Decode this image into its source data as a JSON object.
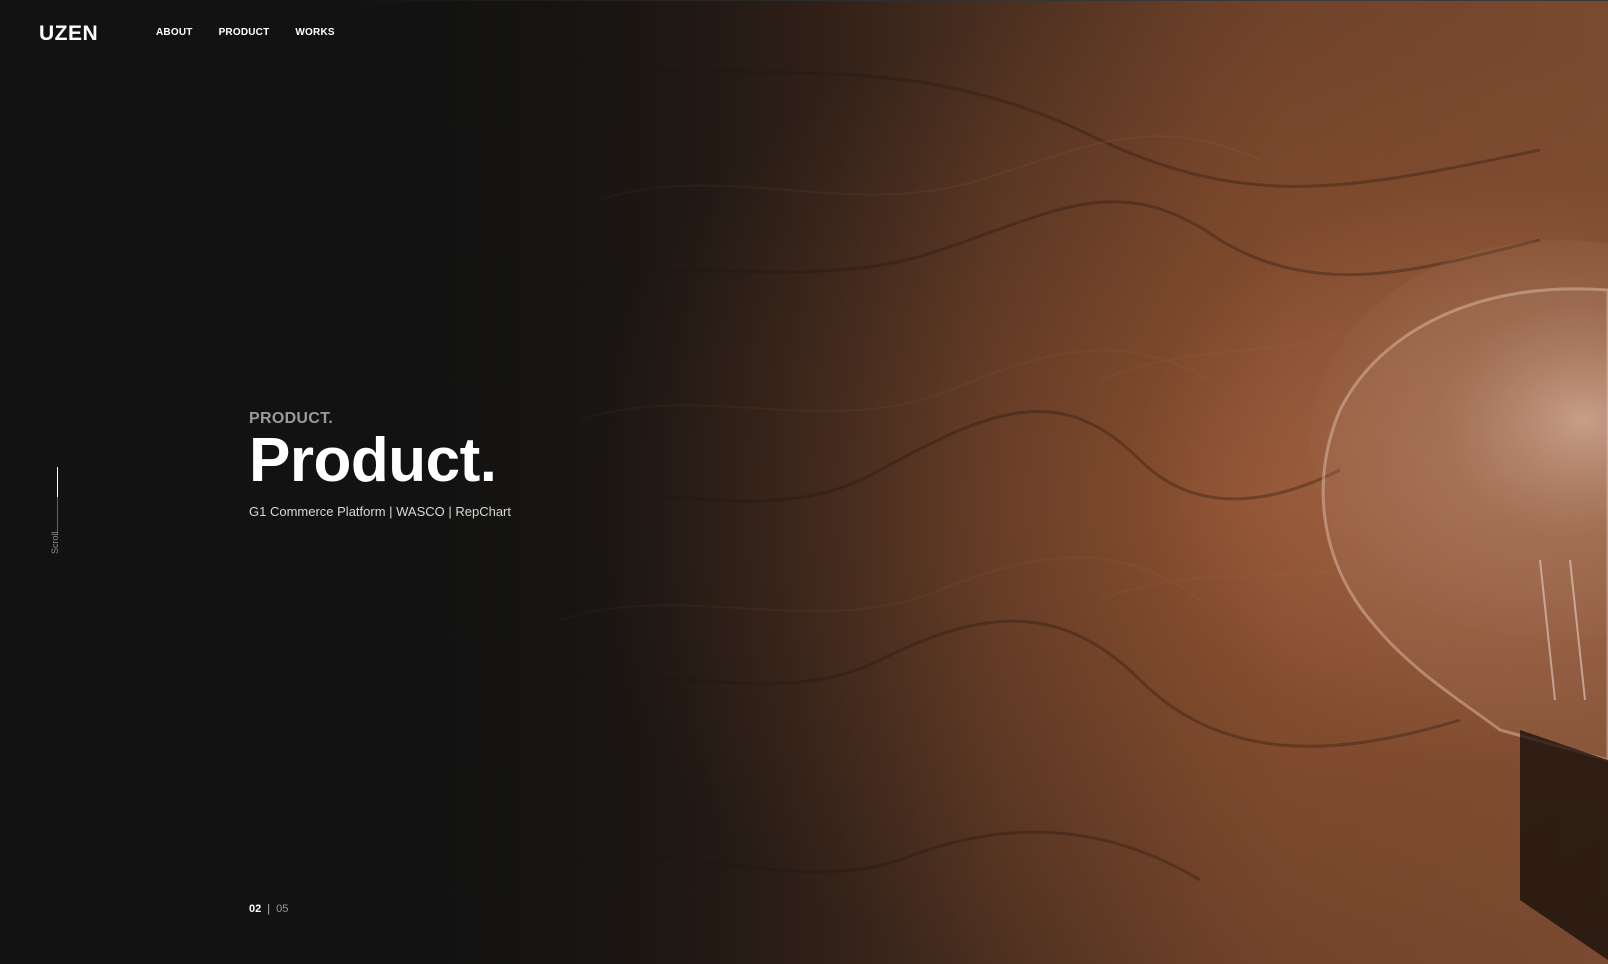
{
  "header": {
    "logo": "UZEN",
    "nav": [
      {
        "label": "ABOUT"
      },
      {
        "label": "PRODUCT"
      },
      {
        "label": "WORKS"
      }
    ]
  },
  "side": {
    "scroll_label": "Scroll"
  },
  "hero": {
    "eyebrow": "PRODUCT.",
    "title": "Product.",
    "subtitle": "G1 Commerce Platform | WASCO | RepChart"
  },
  "pager": {
    "current": "02",
    "separator": "|",
    "total": "05"
  },
  "colors": {
    "background": "#141414",
    "wood": "#7a4a30",
    "text": "#ffffff",
    "muted": "#9a9a9a"
  },
  "icons": {
    "background": "light-bulb-on-wood-image"
  }
}
